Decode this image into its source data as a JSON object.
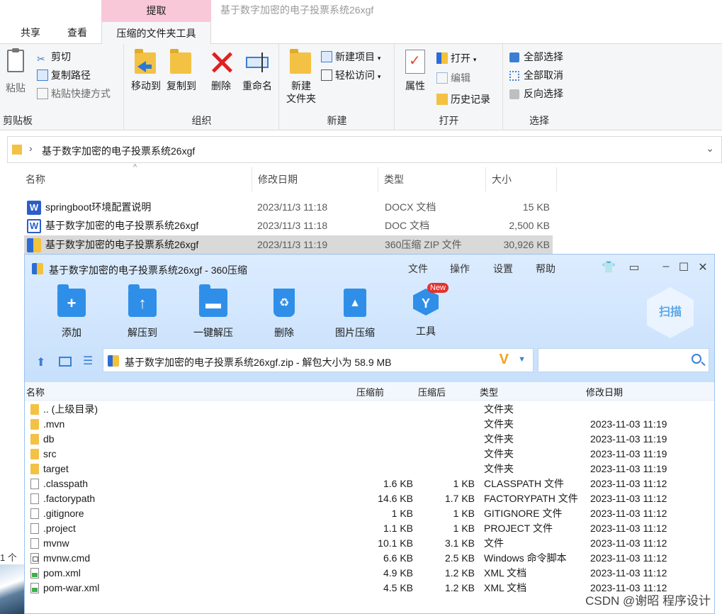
{
  "explorer": {
    "context_tab_group": "提取",
    "window_title": "基于数字加密的电子投票系统26xgf",
    "tabs": [
      "共享",
      "查看",
      "压缩的文件夹工具"
    ],
    "ribbon": {
      "clipboard": {
        "label": "剪贴板",
        "paste": "粘贴",
        "cut": "剪切",
        "copy_path": "复制路径",
        "paste_shortcut": "粘贴快捷方式"
      },
      "organize": {
        "label": "组织",
        "move_to": "移动到",
        "copy_to": "复制到",
        "delete": "删除",
        "rename": "重命名"
      },
      "new": {
        "label": "新建",
        "new_folder_line1": "新建",
        "new_folder_line2": "文件夹",
        "new_item": "新建项目",
        "easy_access": "轻松访问"
      },
      "open": {
        "label": "打开",
        "properties": "属性",
        "open": "打开",
        "edit": "编辑",
        "history": "历史记录"
      },
      "select": {
        "label": "选择",
        "select_all": "全部选择",
        "select_none": "全部取消",
        "invert": "反向选择"
      }
    },
    "address": "基于数字加密的电子投票系统26xgf",
    "columns": {
      "name": "名称",
      "date": "修改日期",
      "type": "类型",
      "size": "大小"
    },
    "files": [
      {
        "name": "springboot环境配置说明",
        "date": "2023/11/3 11:18",
        "type": "DOCX 文档",
        "size": "15 KB",
        "icon": "word-docx-icon"
      },
      {
        "name": "基于数字加密的电子投票系统26xgf",
        "date": "2023/11/3 11:18",
        "type": "DOC 文档",
        "size": "2,500 KB",
        "icon": "word-doc-icon"
      },
      {
        "name": "基于数字加密的电子投票系统26xgf",
        "date": "2023/11/3 11:19",
        "type": "360压缩 ZIP 文件",
        "size": "30,926 KB",
        "icon": "zip-icon"
      }
    ],
    "left_edge_text": "1 个"
  },
  "archiver": {
    "title": "基于数字加密的电子投票系统26xgf - 360压缩",
    "menu": [
      "文件",
      "操作",
      "设置",
      "帮助"
    ],
    "tools": [
      {
        "label": "添加",
        "icon": "add-folder-icon"
      },
      {
        "label": "解压到",
        "icon": "extract-to-icon"
      },
      {
        "label": "一键解压",
        "icon": "one-click-extract-icon"
      },
      {
        "label": "删除",
        "icon": "trash-icon"
      },
      {
        "label": "图片压缩",
        "icon": "image-compress-icon"
      },
      {
        "label": "工具",
        "icon": "tools-icon"
      }
    ],
    "new_badge": "New",
    "scan_label": "扫描",
    "path": "基于数字加密的电子投票系统26xgf.zip - 解包大小为 58.9 MB",
    "path_logo": "V",
    "columns": {
      "name": "名称",
      "before": "压缩前",
      "after": "压缩后",
      "type": "类型",
      "date": "修改日期"
    },
    "rows": [
      {
        "name": ".. (上级目录)",
        "before": "",
        "after": "",
        "type": "文件夹",
        "date": "",
        "icon": "fold"
      },
      {
        "name": ".mvn",
        "before": "",
        "after": "",
        "type": "文件夹",
        "date": "2023-11-03 11:19",
        "icon": "fold"
      },
      {
        "name": "db",
        "before": "",
        "after": "",
        "type": "文件夹",
        "date": "2023-11-03 11:19",
        "icon": "fold"
      },
      {
        "name": "src",
        "before": "",
        "after": "",
        "type": "文件夹",
        "date": "2023-11-03 11:19",
        "icon": "fold"
      },
      {
        "name": "target",
        "before": "",
        "after": "",
        "type": "文件夹",
        "date": "2023-11-03 11:19",
        "icon": "fold"
      },
      {
        "name": ".classpath",
        "before": "1.6 KB",
        "after": "1 KB",
        "type": "CLASSPATH 文件",
        "date": "2023-11-03 11:12",
        "icon": "file"
      },
      {
        "name": ".factorypath",
        "before": "14.6 KB",
        "after": "1.7 KB",
        "type": "FACTORYPATH 文件",
        "date": "2023-11-03 11:12",
        "icon": "file"
      },
      {
        "name": ".gitignore",
        "before": "1 KB",
        "after": "1 KB",
        "type": "GITIGNORE 文件",
        "date": "2023-11-03 11:12",
        "icon": "file"
      },
      {
        "name": ".project",
        "before": "1.1 KB",
        "after": "1 KB",
        "type": "PROJECT 文件",
        "date": "2023-11-03 11:12",
        "icon": "file"
      },
      {
        "name": "mvnw",
        "before": "10.1 KB",
        "after": "3.1 KB",
        "type": "文件",
        "date": "2023-11-03 11:12",
        "icon": "file"
      },
      {
        "name": "mvnw.cmd",
        "before": "6.6 KB",
        "after": "2.5 KB",
        "type": "Windows 命令脚本",
        "date": "2023-11-03 11:12",
        "icon": "cmd"
      },
      {
        "name": "pom.xml",
        "before": "4.9 KB",
        "after": "1.2 KB",
        "type": "XML 文档",
        "date": "2023-11-03 11:12",
        "icon": "xml"
      },
      {
        "name": "pom-war.xml",
        "before": "4.5 KB",
        "after": "1.2 KB",
        "type": "XML 文档",
        "date": "2023-11-03 11:12",
        "icon": "xml"
      }
    ]
  },
  "watermark": "CSDN @谢昭  程序设计"
}
